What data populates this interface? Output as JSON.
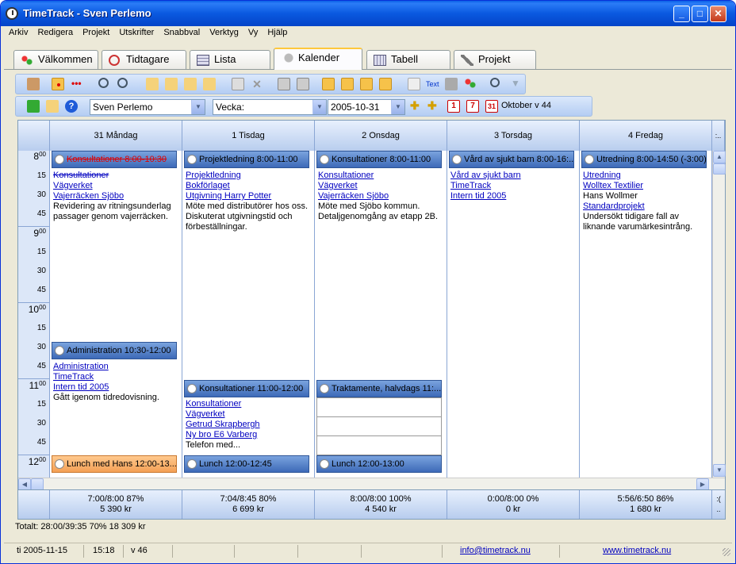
{
  "window": {
    "title": "TimeTrack - Sven Perlemo"
  },
  "menu": [
    "Arkiv",
    "Redigera",
    "Projekt",
    "Utskrifter",
    "Snabbval",
    "Verktyg",
    "Vy",
    "Hjälp"
  ],
  "tabs": [
    "Välkommen",
    "Tidtagare",
    "Lista",
    "Kalender",
    "Tabell",
    "Projekt"
  ],
  "active_tab": "Kalender",
  "toolbar2": {
    "user": "Sven Perlemo",
    "view": "Vecka:",
    "date": "2005-10-31",
    "day_icon": "1",
    "week_icon": "7",
    "month_icon": "31",
    "period": "Oktober v 44",
    "text_btn": "Text"
  },
  "days": [
    "31 Måndag",
    "1 Tisdag",
    "2 Onsdag",
    "3 Torsdag",
    "4 Fredag"
  ],
  "overflow_header": ":..",
  "hours": [
    "8",
    "9",
    "10",
    "11",
    "12"
  ],
  "hour_sup": "00",
  "quarters": [
    "15",
    "30",
    "45"
  ],
  "events": {
    "mon1": {
      "title": "Konsultationer 8:00-10:30",
      "links": [
        "Konsultationer",
        "Vägverket",
        "Vajerräcken Sjöbo"
      ],
      "note": "Revidering av ritningsunderlag passager genom vajerräcken."
    },
    "mon2": {
      "title": "Administration 10:30-12:00",
      "links": [
        "Administration",
        "TimeTrack",
        "Intern tid 2005"
      ],
      "note": "Gått igenom tidredovisning."
    },
    "mon3": {
      "title": "Lunch med Hans 12:00-13..."
    },
    "tue1": {
      "title": "Projektledning 8:00-11:00",
      "links": [
        "Projektledning",
        "Bokförlaget",
        "Utgivning Harry Potter"
      ],
      "note": "Möte med distributörer hos oss. Diskuterat utgivningstid och förbeställningar."
    },
    "tue2": {
      "title": "Konsultationer 11:00-12:00",
      "links": [
        "Konsultationer",
        "Vägverket",
        "Getrud Skrapbergh",
        "Ny bro E6 Varberg"
      ],
      "note": "Telefon med..."
    },
    "tue3": {
      "title": "Lunch 12:00-12:45"
    },
    "wed1": {
      "title": "Konsultationer 8:00-11:00",
      "links": [
        "Konsultationer",
        "Vägverket",
        "Vajerräcken Sjöbo"
      ],
      "note": "Möte med Sjöbo kommun. Detaljgenomgång av etapp 2B."
    },
    "wed2": {
      "title": "Traktamente, halvdags 11:..."
    },
    "wed3": {
      "title": "Lunch 12:00-13:00"
    },
    "thu1": {
      "title": "Vård av sjukt barn 8:00-16:...",
      "links": [
        "Vård av sjukt barn",
        "TimeTrack",
        "Intern tid 2005"
      ]
    },
    "fri1": {
      "title": "Utredning 8:00-14:50 (-3:00)",
      "links": [
        "Utredning",
        "Wolltex Textilier"
      ],
      "text1": "Hans Wollmer",
      "link3": "Standardprojekt",
      "note": "Undersökt tidigare fall av liknande varumärkesintrång."
    }
  },
  "totals": [
    {
      "line1": "7:00/8:00 87%",
      "line2": "5 390 kr"
    },
    {
      "line1": "7:04/8:45 80%",
      "line2": "6 699 kr"
    },
    {
      "line1": "8:00/8:00 100%",
      "line2": "4 540 kr"
    },
    {
      "line1": "0:00/8:00 0%",
      "line2": "0 kr"
    },
    {
      "line1": "5:56/6:50 86%",
      "line2": "1 680 kr"
    }
  ],
  "totals_overflow": ":(\n..",
  "grand_total": "Totalt: 28:00/39:35 70% 18 309 kr",
  "status": {
    "date": "ti 2005-11-15",
    "time": "15:18",
    "week": "v 46",
    "email": "info@timetrack.nu",
    "web": "www.timetrack.nu"
  },
  "colors": {
    "titlebar": "#0a5fe6",
    "event_header": "#5b86cc",
    "lunch_event": "#f4a055",
    "link": "#0000c0",
    "strike_red": "#e00000"
  }
}
